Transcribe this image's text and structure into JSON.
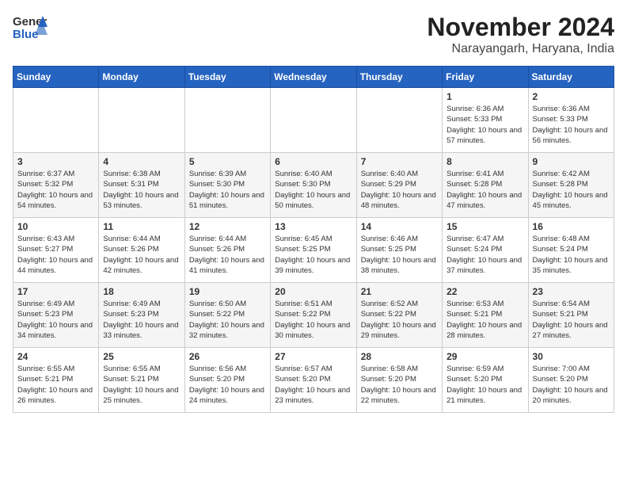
{
  "header": {
    "logo_general": "General",
    "logo_blue": "Blue",
    "month_title": "November 2024",
    "location": "Narayangarh, Haryana, India"
  },
  "weekdays": [
    "Sunday",
    "Monday",
    "Tuesday",
    "Wednesday",
    "Thursday",
    "Friday",
    "Saturday"
  ],
  "weeks": [
    [
      {
        "day": "",
        "sunrise": "",
        "sunset": "",
        "daylight": ""
      },
      {
        "day": "",
        "sunrise": "",
        "sunset": "",
        "daylight": ""
      },
      {
        "day": "",
        "sunrise": "",
        "sunset": "",
        "daylight": ""
      },
      {
        "day": "",
        "sunrise": "",
        "sunset": "",
        "daylight": ""
      },
      {
        "day": "",
        "sunrise": "",
        "sunset": "",
        "daylight": ""
      },
      {
        "day": "1",
        "sunrise": "Sunrise: 6:36 AM",
        "sunset": "Sunset: 5:33 PM",
        "daylight": "Daylight: 10 hours and 57 minutes."
      },
      {
        "day": "2",
        "sunrise": "Sunrise: 6:36 AM",
        "sunset": "Sunset: 5:33 PM",
        "daylight": "Daylight: 10 hours and 56 minutes."
      }
    ],
    [
      {
        "day": "3",
        "sunrise": "Sunrise: 6:37 AM",
        "sunset": "Sunset: 5:32 PM",
        "daylight": "Daylight: 10 hours and 54 minutes."
      },
      {
        "day": "4",
        "sunrise": "Sunrise: 6:38 AM",
        "sunset": "Sunset: 5:31 PM",
        "daylight": "Daylight: 10 hours and 53 minutes."
      },
      {
        "day": "5",
        "sunrise": "Sunrise: 6:39 AM",
        "sunset": "Sunset: 5:30 PM",
        "daylight": "Daylight: 10 hours and 51 minutes."
      },
      {
        "day": "6",
        "sunrise": "Sunrise: 6:40 AM",
        "sunset": "Sunset: 5:30 PM",
        "daylight": "Daylight: 10 hours and 50 minutes."
      },
      {
        "day": "7",
        "sunrise": "Sunrise: 6:40 AM",
        "sunset": "Sunset: 5:29 PM",
        "daylight": "Daylight: 10 hours and 48 minutes."
      },
      {
        "day": "8",
        "sunrise": "Sunrise: 6:41 AM",
        "sunset": "Sunset: 5:28 PM",
        "daylight": "Daylight: 10 hours and 47 minutes."
      },
      {
        "day": "9",
        "sunrise": "Sunrise: 6:42 AM",
        "sunset": "Sunset: 5:28 PM",
        "daylight": "Daylight: 10 hours and 45 minutes."
      }
    ],
    [
      {
        "day": "10",
        "sunrise": "Sunrise: 6:43 AM",
        "sunset": "Sunset: 5:27 PM",
        "daylight": "Daylight: 10 hours and 44 minutes."
      },
      {
        "day": "11",
        "sunrise": "Sunrise: 6:44 AM",
        "sunset": "Sunset: 5:26 PM",
        "daylight": "Daylight: 10 hours and 42 minutes."
      },
      {
        "day": "12",
        "sunrise": "Sunrise: 6:44 AM",
        "sunset": "Sunset: 5:26 PM",
        "daylight": "Daylight: 10 hours and 41 minutes."
      },
      {
        "day": "13",
        "sunrise": "Sunrise: 6:45 AM",
        "sunset": "Sunset: 5:25 PM",
        "daylight": "Daylight: 10 hours and 39 minutes."
      },
      {
        "day": "14",
        "sunrise": "Sunrise: 6:46 AM",
        "sunset": "Sunset: 5:25 PM",
        "daylight": "Daylight: 10 hours and 38 minutes."
      },
      {
        "day": "15",
        "sunrise": "Sunrise: 6:47 AM",
        "sunset": "Sunset: 5:24 PM",
        "daylight": "Daylight: 10 hours and 37 minutes."
      },
      {
        "day": "16",
        "sunrise": "Sunrise: 6:48 AM",
        "sunset": "Sunset: 5:24 PM",
        "daylight": "Daylight: 10 hours and 35 minutes."
      }
    ],
    [
      {
        "day": "17",
        "sunrise": "Sunrise: 6:49 AM",
        "sunset": "Sunset: 5:23 PM",
        "daylight": "Daylight: 10 hours and 34 minutes."
      },
      {
        "day": "18",
        "sunrise": "Sunrise: 6:49 AM",
        "sunset": "Sunset: 5:23 PM",
        "daylight": "Daylight: 10 hours and 33 minutes."
      },
      {
        "day": "19",
        "sunrise": "Sunrise: 6:50 AM",
        "sunset": "Sunset: 5:22 PM",
        "daylight": "Daylight: 10 hours and 32 minutes."
      },
      {
        "day": "20",
        "sunrise": "Sunrise: 6:51 AM",
        "sunset": "Sunset: 5:22 PM",
        "daylight": "Daylight: 10 hours and 30 minutes."
      },
      {
        "day": "21",
        "sunrise": "Sunrise: 6:52 AM",
        "sunset": "Sunset: 5:22 PM",
        "daylight": "Daylight: 10 hours and 29 minutes."
      },
      {
        "day": "22",
        "sunrise": "Sunrise: 6:53 AM",
        "sunset": "Sunset: 5:21 PM",
        "daylight": "Daylight: 10 hours and 28 minutes."
      },
      {
        "day": "23",
        "sunrise": "Sunrise: 6:54 AM",
        "sunset": "Sunset: 5:21 PM",
        "daylight": "Daylight: 10 hours and 27 minutes."
      }
    ],
    [
      {
        "day": "24",
        "sunrise": "Sunrise: 6:55 AM",
        "sunset": "Sunset: 5:21 PM",
        "daylight": "Daylight: 10 hours and 26 minutes."
      },
      {
        "day": "25",
        "sunrise": "Sunrise: 6:55 AM",
        "sunset": "Sunset: 5:21 PM",
        "daylight": "Daylight: 10 hours and 25 minutes."
      },
      {
        "day": "26",
        "sunrise": "Sunrise: 6:56 AM",
        "sunset": "Sunset: 5:20 PM",
        "daylight": "Daylight: 10 hours and 24 minutes."
      },
      {
        "day": "27",
        "sunrise": "Sunrise: 6:57 AM",
        "sunset": "Sunset: 5:20 PM",
        "daylight": "Daylight: 10 hours and 23 minutes."
      },
      {
        "day": "28",
        "sunrise": "Sunrise: 6:58 AM",
        "sunset": "Sunset: 5:20 PM",
        "daylight": "Daylight: 10 hours and 22 minutes."
      },
      {
        "day": "29",
        "sunrise": "Sunrise: 6:59 AM",
        "sunset": "Sunset: 5:20 PM",
        "daylight": "Daylight: 10 hours and 21 minutes."
      },
      {
        "day": "30",
        "sunrise": "Sunrise: 7:00 AM",
        "sunset": "Sunset: 5:20 PM",
        "daylight": "Daylight: 10 hours and 20 minutes."
      }
    ]
  ]
}
